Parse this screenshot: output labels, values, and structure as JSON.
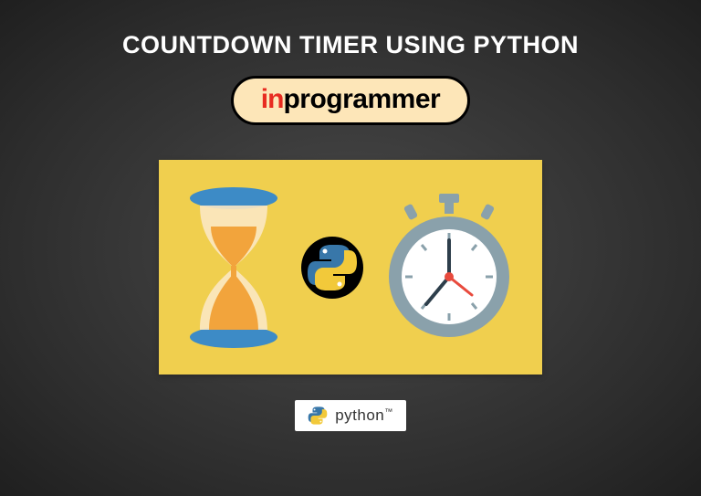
{
  "title": "COUNTDOWN TIMER USING PYTHON",
  "branding": {
    "prefix": "in",
    "suffix": "programmer"
  },
  "icons": {
    "hourglass": "hourglass-icon",
    "python": "python-logo-icon",
    "stopwatch": "stopwatch-icon"
  },
  "footer": {
    "label": "python",
    "tm": "™"
  },
  "colors": {
    "card_bg": "#f0cf4e",
    "pill_bg": "#fde6b8",
    "accent_red": "#e82b20",
    "hourglass_blue": "#3d8bc6",
    "hourglass_sand": "#f2a43c",
    "stopwatch_grey": "#8aa1ab",
    "stopwatch_face": "#ffffff",
    "stopwatch_hand": "#e84a3d"
  }
}
